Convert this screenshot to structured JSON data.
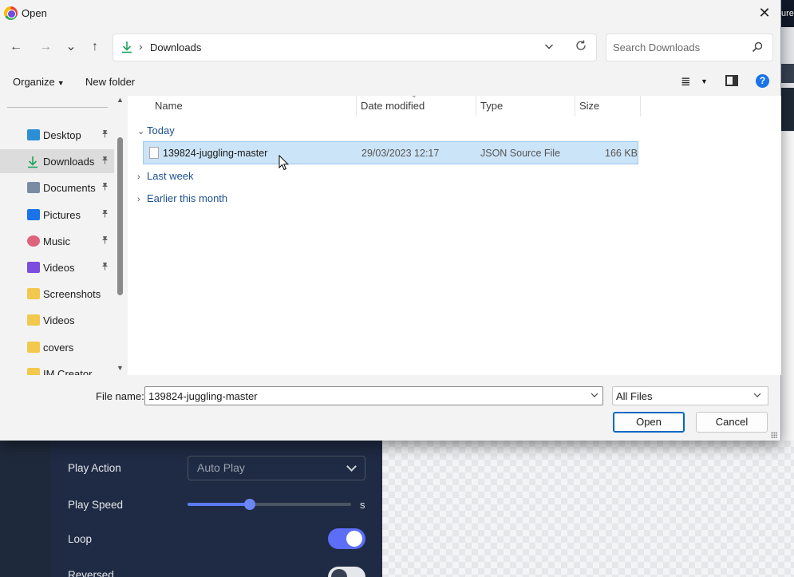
{
  "dialog": {
    "title": "Open",
    "close_glyph": "✕"
  },
  "nav": {
    "back_glyph": "←",
    "forward_glyph": "→",
    "recent_glyph": "⌄",
    "up_glyph": "↑",
    "address_path": "Downloads",
    "address_sep": "›",
    "search_placeholder": "Search Downloads"
  },
  "commands": {
    "organize": "Organize",
    "new_folder": "New folder"
  },
  "sidebar": {
    "items": [
      {
        "label": "Desktop",
        "icon": "desktop-icon",
        "color": "#2b8fd6",
        "pinned": true
      },
      {
        "label": "Downloads",
        "icon": "download-icon",
        "color": "#1ea35e",
        "pinned": true,
        "selected": true
      },
      {
        "label": "Documents",
        "icon": "documents-icon",
        "color": "#7a8ca3",
        "pinned": true
      },
      {
        "label": "Pictures",
        "icon": "pictures-icon",
        "color": "#1a73e8",
        "pinned": true
      },
      {
        "label": "Music",
        "icon": "music-icon",
        "color": "#e0637c",
        "pinned": true
      },
      {
        "label": "Videos",
        "icon": "videos-icon",
        "color": "#7b4ee0",
        "pinned": true
      },
      {
        "label": "Screenshots",
        "icon": "folder-icon",
        "color": "#f2c94c",
        "pinned": false
      },
      {
        "label": "Videos",
        "icon": "folder-icon",
        "color": "#f2c94c",
        "pinned": false
      },
      {
        "label": "covers",
        "icon": "folder-icon",
        "color": "#f2c94c",
        "pinned": false
      },
      {
        "label": "IM Creator",
        "icon": "folder-icon",
        "color": "#f2c94c",
        "pinned": false
      }
    ],
    "pin_glyph": "📌"
  },
  "columns": {
    "name": "Name",
    "date": "Date modified",
    "type": "Type",
    "size": "Size"
  },
  "groups": {
    "today": "Today",
    "last_week": "Last week",
    "earlier": "Earlier this month"
  },
  "files": [
    {
      "name": "139824-juggling-master",
      "date": "29/03/2023 12:17",
      "type": "JSON Source File",
      "size": "166 KB",
      "selected": true
    }
  ],
  "footer": {
    "file_name_label": "File name:",
    "file_name_value": "139824-juggling-master",
    "file_type": "All Files",
    "open": "Open",
    "cancel": "Cancel"
  },
  "background_app": {
    "top_right_text": "ure",
    "play_action_label": "Play Action",
    "play_action_value": "Auto Play",
    "play_speed_label": "Play Speed",
    "play_speed_unit": "s",
    "play_speed_fraction": 0.38,
    "loop_label": "Loop",
    "loop_on": true,
    "reversed_label": "Reversed",
    "reversed_on": false,
    "accent_color": "#5b6ef5"
  }
}
